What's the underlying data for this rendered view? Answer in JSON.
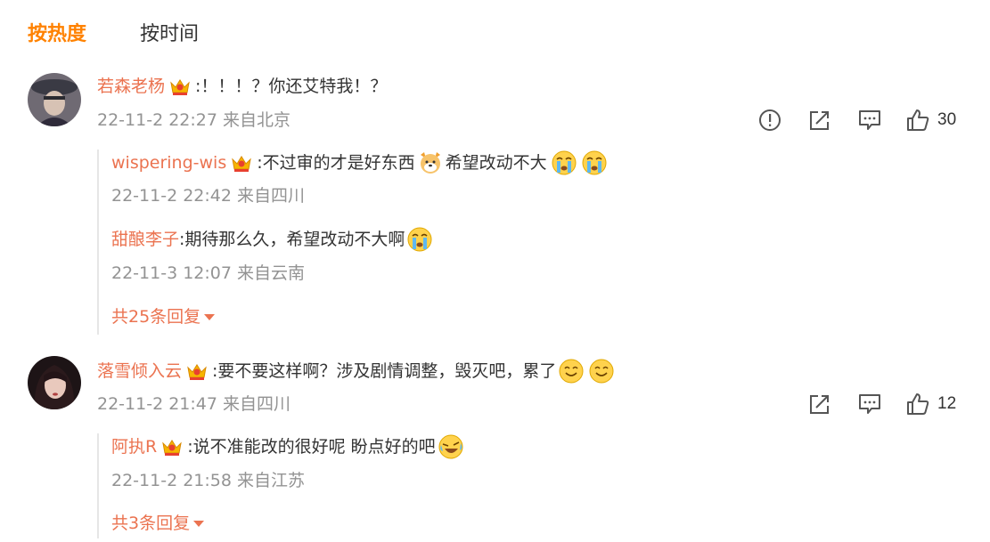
{
  "tabs": {
    "hot": "按热度",
    "time": "按时间"
  },
  "comments": [
    {
      "user": "若森老杨",
      "text": ":！！！？你还艾特我！？",
      "meta": "22-11-2 22:27 来自北京",
      "likes": "30",
      "replies": [
        {
          "user": "wispering-wis",
          "text1": ":不过审的才是好东西",
          "text2": " 希望改动不大",
          "meta": "22-11-2 22:42 来自四川"
        },
        {
          "user": "甜酿李子",
          "text1": ":期待那么久，希望改动不大啊",
          "meta": "22-11-3 12:07 来自云南"
        }
      ],
      "more": "共25条回复"
    },
    {
      "user": "落雪倾入云",
      "text": ":要不要这样啊？涉及剧情调整，毁灭吧，累了",
      "meta": "22-11-2 21:47 来自四川",
      "likes": "12",
      "replies": [
        {
          "user": "阿执R",
          "text1": ":说不准能改的很好呢 盼点好的吧",
          "meta": "22-11-2 21:58 来自江苏"
        }
      ],
      "more": "共3条回复"
    }
  ],
  "colors": {
    "accent": "#ff8200",
    "username": "#eb7350",
    "meta": "#939393",
    "icon": "#555555"
  },
  "icons": [
    "report-icon",
    "share-icon",
    "comment-icon",
    "like-icon",
    "cry-emoji",
    "dog-emoji",
    "grin-emoji",
    "laugh-cry-emoji",
    "crown-badge"
  ]
}
